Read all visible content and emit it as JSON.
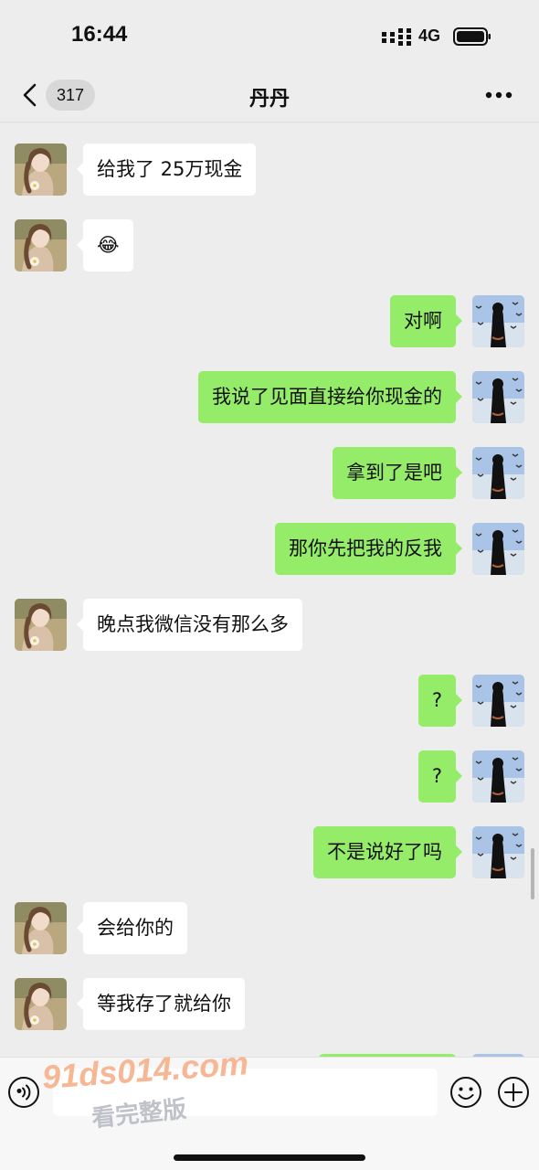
{
  "status_bar": {
    "time": "16:44",
    "network": "4G",
    "signal_icon": "cellular-signal-icon",
    "battery_icon": "battery-icon"
  },
  "nav": {
    "back_icon": "chevron-left-icon",
    "unread_count": "317",
    "title": "丹丹",
    "more_icon": "ellipsis-icon"
  },
  "messages": [
    {
      "side": "left",
      "text": "给我了 25万现金"
    },
    {
      "side": "left",
      "text": "😂"
    },
    {
      "side": "right",
      "text": "对啊"
    },
    {
      "side": "right",
      "text": "我说了见面直接给你现金的"
    },
    {
      "side": "right",
      "text": "拿到了是吧"
    },
    {
      "side": "right",
      "text": "那你先把我的反我"
    },
    {
      "side": "left",
      "text": "晚点我微信没有那么多"
    },
    {
      "side": "right",
      "text": "?"
    },
    {
      "side": "right",
      "text": "?"
    },
    {
      "side": "right",
      "text": "不是说好了吗"
    },
    {
      "side": "left",
      "text": "会给你的"
    },
    {
      "side": "left",
      "text": "等我存了就给你"
    },
    {
      "side": "right",
      "text": ""
    }
  ],
  "input_bar": {
    "voice_icon": "voice-icon",
    "placeholder": "",
    "emoji_icon": "emoji-icon",
    "plus_icon": "plus-circle-icon"
  },
  "watermark": {
    "url": "91ds014.com",
    "text": "看完整版"
  },
  "colors": {
    "background": "#ededed",
    "sent_bubble": "#95ec69",
    "received_bubble": "#ffffff"
  }
}
